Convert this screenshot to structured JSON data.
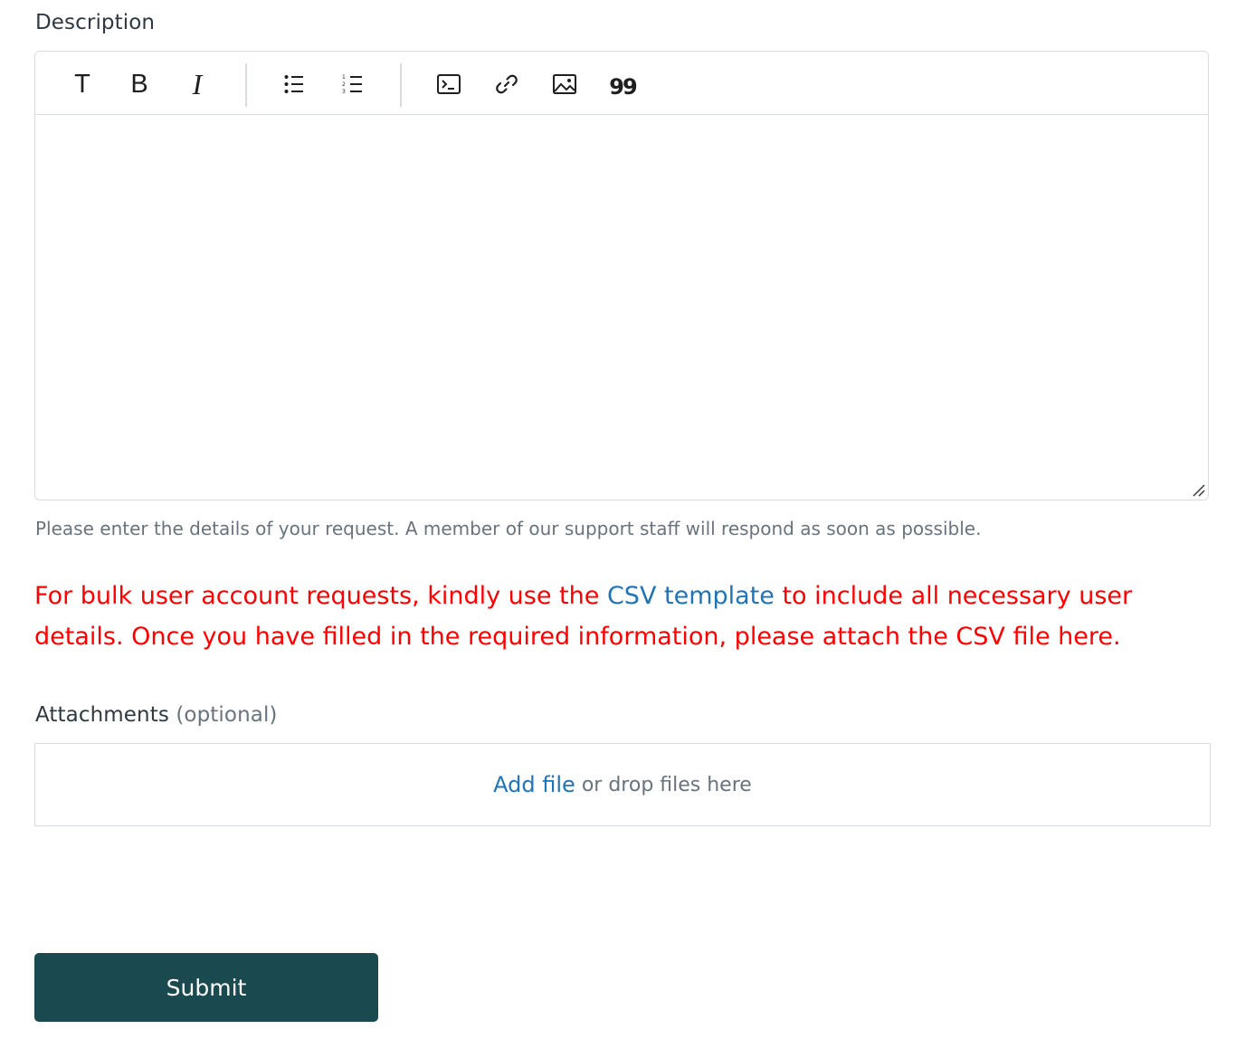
{
  "description": {
    "label": "Description",
    "toolbar": {
      "items": [
        {
          "name": "text-format-icon",
          "glyph": "T"
        },
        {
          "name": "bold-icon",
          "glyph": "B"
        },
        {
          "name": "italic-icon",
          "glyph": "I"
        },
        {
          "name": "bulleted-list-icon"
        },
        {
          "name": "numbered-list-icon"
        },
        {
          "name": "code-block-icon"
        },
        {
          "name": "link-icon"
        },
        {
          "name": "image-icon"
        },
        {
          "name": "quote-icon"
        }
      ]
    },
    "value": "",
    "hint": "Please enter the details of your request. A member of our support staff will respond as soon as possible."
  },
  "notice": {
    "before_link": "For bulk user account requests, kindly use the ",
    "link_text": "CSV template",
    "after_link": " to include all necessary user details. Once you have filled in the required information, please attach the CSV file here.",
    "color": "#ff0000",
    "link_color": "#1f73b7"
  },
  "attachments": {
    "label": "Attachments",
    "optional_label": "(optional)",
    "add_file_label": "Add file",
    "drop_text": "or drop files here"
  },
  "submit": {
    "label": "Submit",
    "color": "#1a4a4f"
  }
}
